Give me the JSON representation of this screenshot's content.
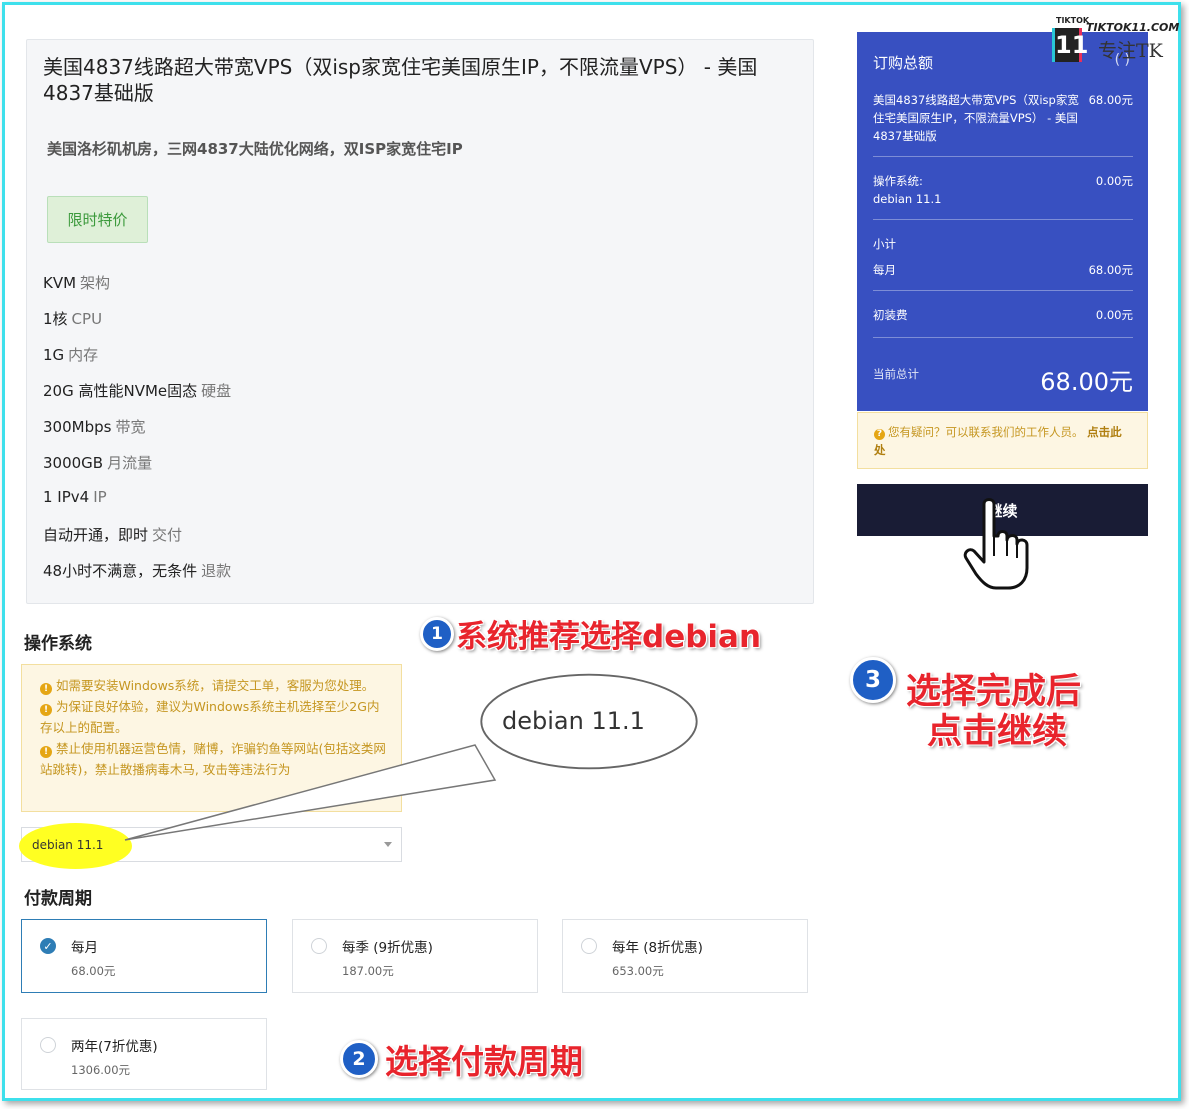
{
  "product": {
    "title": "美国4837线路超大带宽VPS（双isp家宽住宅美国原生IP，不限流量VPS） - 美国4837基础版",
    "tagline": "美国洛杉矶机房，三网4837大陆优化网络，双ISP家宽住宅IP",
    "promo_label": "限时特价",
    "specs": [
      {
        "value": "KVM",
        "unit": "架构"
      },
      {
        "value": "1核",
        "unit": "CPU"
      },
      {
        "value": "1G",
        "unit": "内存"
      },
      {
        "value": "20G 高性能NVMe固态",
        "unit": "硬盘"
      },
      {
        "value": "300Mbps",
        "unit": "带宽"
      },
      {
        "value": "3000GB",
        "unit": "月流量"
      },
      {
        "value": "1 IPv4",
        "unit": "IP"
      },
      {
        "value": "自动开通，即时",
        "unit": "交付"
      },
      {
        "value": "48小时不满意，无条件",
        "unit": "退款"
      }
    ]
  },
  "os": {
    "title": "操作系统",
    "notices": [
      "如需要安装Windows系统，请提交工单，客服为您处理。",
      "为保证良好体验，建议为Windows系统主机选择至少2G内存以上的配置。",
      "禁止使用机器运营色情，赌博，诈骗钓鱼等网站(包括这类网站跳转)，禁止散播病毒木马, 攻击等违法行为"
    ],
    "selected": "debian 11.1",
    "zoom_text": "debian 11.1"
  },
  "billing": {
    "title": "付款周期",
    "options": [
      {
        "label": "每月",
        "price": "68.00元",
        "selected": true
      },
      {
        "label": "每季 (9折优惠)",
        "price": "187.00元",
        "selected": false
      },
      {
        "label": "每年 (8折优惠)",
        "price": "653.00元",
        "selected": false
      },
      {
        "label": "两年(7折优惠)",
        "price": "1306.00元",
        "selected": false
      }
    ]
  },
  "summary": {
    "title": "订购总额",
    "product_name": "美国4837线路超大带宽VPS（双isp家宽住宅美国原生IP，不限流量VPS） - 美国4837基础版",
    "product_price": "68.00元",
    "os_label": "操作系统:",
    "os_value": "debian 11.1",
    "os_price": "0.00元",
    "subtotal_label": "小计",
    "monthly_label": "每月",
    "monthly_price": "68.00元",
    "setup_label": "初装费",
    "setup_price": "0.00元",
    "total_label": "当前总计",
    "total": "68.00元",
    "help_text": "您有疑问？可以联系我们的工作人员。",
    "help_link": "点击此处",
    "continue_label": "继续"
  },
  "logo": {
    "small": "TIKTOK",
    "mark": "11",
    "url": "TIKTOK11.COM",
    "slogan": "专注TK"
  },
  "annotations": {
    "step1_num": "1",
    "step1": "系统推荐选择debian",
    "step2_num": "2",
    "step2": "选择付款周期",
    "step3_num": "3",
    "step3_line1": "选择完成后",
    "step3_line2": "点击继续"
  },
  "colors": {
    "summary_bg": "#3850c1",
    "continue_bg": "#191c35",
    "annotation_red": "#e8242c",
    "badge_blue": "#1f5fc5",
    "frame": "#3ee0ec"
  }
}
